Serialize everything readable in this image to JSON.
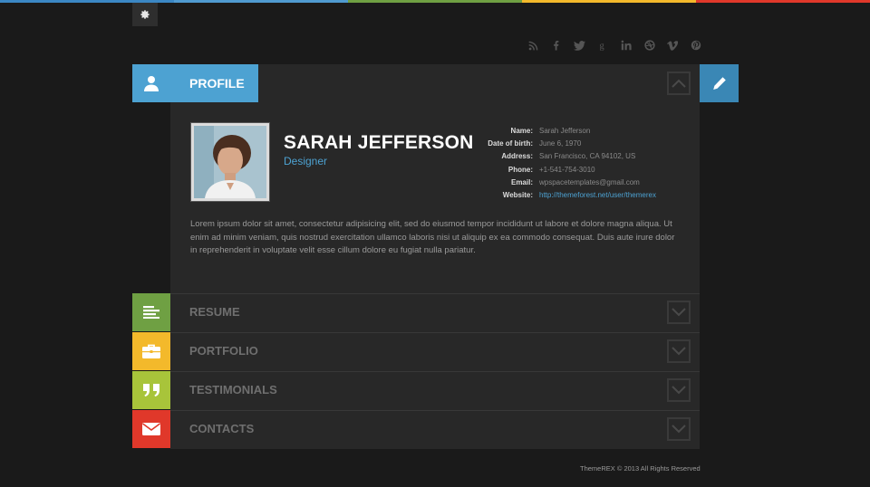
{
  "topbar": {
    "colors": [
      "#3b87c4",
      "#4f9ad0",
      "#6fa043",
      "#f3b92b",
      "#e0382a"
    ]
  },
  "settings": {
    "icon": "gear-icon"
  },
  "social": {
    "icons": [
      "rss-icon",
      "facebook-icon",
      "twitter-icon",
      "google-plus-icon",
      "linkedin-icon",
      "dribbble-icon",
      "vimeo-icon",
      "pinterest-icon"
    ]
  },
  "profile": {
    "tab_label": "PROFILE",
    "name": "SARAH JEFFERSON",
    "role": "Designer",
    "details": [
      {
        "label": "Name:",
        "value": "Sarah Jefferson"
      },
      {
        "label": "Date of birth:",
        "value": "June 6, 1970"
      },
      {
        "label": "Address:",
        "value": "San Francisco, CA 94102, US"
      },
      {
        "label": "Phone:",
        "value": "+1-541-754-3010"
      },
      {
        "label": "Email:",
        "value": "wpspacetemplates@gmail.com"
      },
      {
        "label": "Website:",
        "value": "http://themeforest.net/user/themerex"
      }
    ],
    "bio": "Lorem ipsum dolor sit amet, consectetur adipisicing elit, sed do eiusmod tempor incididunt ut labore et dolore magna aliqua. Ut enim ad minim veniam, quis nostrud exercitation ullamco laboris nisi ut aliquip ex ea commodo consequat. Duis aute irure dolor in reprehenderit in voluptate velit esse cillum dolore eu fugiat nulla pariatur."
  },
  "sections": [
    {
      "label": "RESUME",
      "color": "#6fa043",
      "icon": "resume-lines-icon"
    },
    {
      "label": "PORTFOLIO",
      "color": "#f3b92b",
      "icon": "briefcase-icon"
    },
    {
      "label": "TESTIMONIALS",
      "color": "#a8c43a",
      "icon": "quote-icon"
    },
    {
      "label": "CONTACTS",
      "color": "#e0382a",
      "icon": "envelope-icon"
    }
  ],
  "footer": {
    "text": "ThemeREX © 2013 All Rights Reserved"
  }
}
